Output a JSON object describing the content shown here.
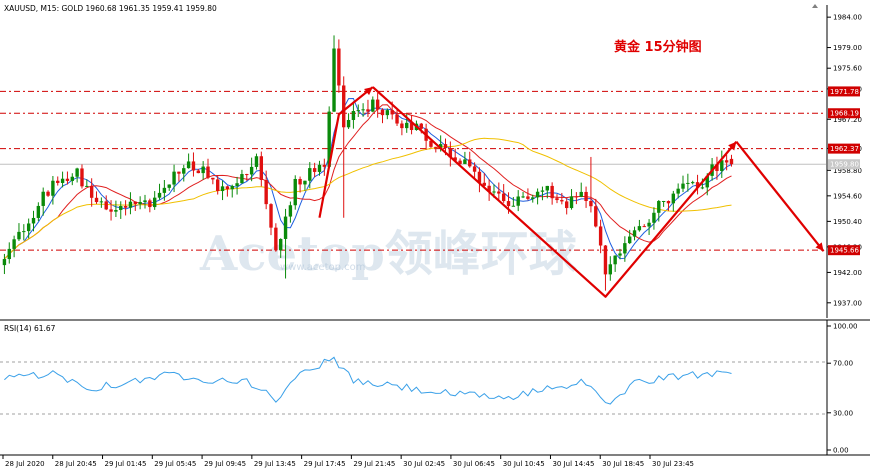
{
  "header": {
    "symbol_line": "XAUUSD, M15:  GOLD  1960.68 1961.35 1959.41 1959.80",
    "rsi_label": "RSI(14) 61.67"
  },
  "annotation": {
    "title": "黄金  15分钟图",
    "color": "#e00000"
  },
  "watermark": {
    "brand": "Acetop领峰环球",
    "url": "www.acetop.com"
  },
  "colors": {
    "bull": "#0a8a0a",
    "bear": "#e01010",
    "ma_fast": "#1e5fe0",
    "ma_mid": "#e02020",
    "ma_slow": "#f0c000",
    "rsi": "#3aa0e8",
    "levels": "#d00000",
    "arrows": "#e00000"
  },
  "chart_data": [
    {
      "type": "candlestick",
      "title": "黄金  15分钟图",
      "series_label": "XAUUSD, M15",
      "ohlc_header": {
        "open": 1960.68,
        "high": 1961.35,
        "low": 1959.41,
        "close": 1959.8
      },
      "ylim": [
        1934.5,
        1986.0
      ],
      "y_ticks": [
        1984.0,
        1979.0,
        1975.6,
        1972.2,
        1967.2,
        1962.4,
        1958.8,
        1954.6,
        1950.4,
        1946.2,
        1942.0,
        1937.0
      ],
      "x_ticks": [
        "28 Jul 2020",
        "28 Jul 20:45",
        "29 Jul 01:45",
        "29 Jul 05:45",
        "29 Jul 09:45",
        "29 Jul 13:45",
        "29 Jul 17:45",
        "29 Jul 21:45",
        "30 Jul 02:45",
        "30 Jul 06:45",
        "30 Jul 10:45",
        "30 Jul 14:45",
        "30 Jul 18:45",
        "30 Jul 23:45"
      ],
      "current_price": 1959.8,
      "levels": [
        {
          "label": "1971.78",
          "value": 1971.78
        },
        {
          "label": "1968.19",
          "value": 1968.19
        },
        {
          "label": "1962.37",
          "value": 1962.37
        },
        {
          "label": "1945.66",
          "value": 1945.66
        }
      ],
      "waypoints": [
        {
          "bar": 0,
          "price": 1944
        },
        {
          "bar": 8,
          "price": 1955
        },
        {
          "bar": 15,
          "price": 1958
        },
        {
          "bar": 22,
          "price": 1952
        },
        {
          "bar": 30,
          "price": 1953
        },
        {
          "bar": 38,
          "price": 1960
        },
        {
          "bar": 46,
          "price": 1955
        },
        {
          "bar": 52,
          "price": 1960
        },
        {
          "bar": 56,
          "price": 1946
        },
        {
          "bar": 60,
          "price": 1957
        },
        {
          "bar": 66,
          "price": 1960
        },
        {
          "bar": 68,
          "price": 1978
        },
        {
          "bar": 70,
          "price": 1965
        },
        {
          "bar": 74,
          "price": 1970
        },
        {
          "bar": 78,
          "price": 1969
        },
        {
          "bar": 84,
          "price": 1966
        },
        {
          "bar": 90,
          "price": 1962
        },
        {
          "bar": 98,
          "price": 1958
        },
        {
          "bar": 104,
          "price": 1952
        },
        {
          "bar": 110,
          "price": 1956
        },
        {
          "bar": 116,
          "price": 1953
        },
        {
          "bar": 120,
          "price": 1955
        },
        {
          "bar": 124,
          "price": 1942
        },
        {
          "bar": 130,
          "price": 1948
        },
        {
          "bar": 136,
          "price": 1954
        },
        {
          "bar": 142,
          "price": 1956
        },
        {
          "bar": 150,
          "price": 1961
        }
      ],
      "spikes": [
        {
          "bar": 58,
          "price": 1941
        },
        {
          "bar": 68,
          "price": 1981
        },
        {
          "bar": 70,
          "price": 1951
        },
        {
          "bar": 121,
          "price": 1961
        },
        {
          "bar": 124,
          "price": 1939
        }
      ],
      "zigzag_arrows": [
        [
          {
            "bar": 65,
            "price": 1951
          },
          {
            "bar": 69,
            "price": 1968
          },
          {
            "bar": 76,
            "price": 1972.5
          }
        ],
        [
          {
            "bar": 76,
            "price": 1972.5
          },
          {
            "bar": 124,
            "price": 1938
          },
          {
            "bar": 151,
            "price": 1963.5
          }
        ],
        [
          {
            "bar": 151,
            "price": 1963.5
          },
          {
            "bar": 169,
            "price": 1945.5
          }
        ]
      ]
    },
    {
      "type": "line",
      "title": "RSI(14) 61.67",
      "ylim": [
        0,
        100
      ],
      "y_ticks": [
        100.0,
        70.0,
        30.0,
        0.0
      ],
      "last_value": 61.67,
      "waypoints": [
        {
          "bar": 0,
          "value": 58
        },
        {
          "bar": 10,
          "value": 62
        },
        {
          "bar": 18,
          "value": 50
        },
        {
          "bar": 26,
          "value": 55
        },
        {
          "bar": 34,
          "value": 61
        },
        {
          "bar": 42,
          "value": 57
        },
        {
          "bar": 50,
          "value": 56
        },
        {
          "bar": 56,
          "value": 40
        },
        {
          "bar": 60,
          "value": 59
        },
        {
          "bar": 68,
          "value": 74
        },
        {
          "bar": 72,
          "value": 55
        },
        {
          "bar": 80,
          "value": 52
        },
        {
          "bar": 88,
          "value": 47
        },
        {
          "bar": 96,
          "value": 44
        },
        {
          "bar": 104,
          "value": 42
        },
        {
          "bar": 112,
          "value": 50
        },
        {
          "bar": 120,
          "value": 55
        },
        {
          "bar": 124,
          "value": 36
        },
        {
          "bar": 130,
          "value": 54
        },
        {
          "bar": 138,
          "value": 59
        },
        {
          "bar": 146,
          "value": 62
        },
        {
          "bar": 150,
          "value": 65
        },
        {
          "bar": 151,
          "value": 61.67
        }
      ]
    }
  ]
}
